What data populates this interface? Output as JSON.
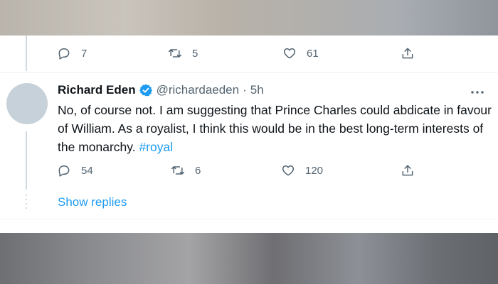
{
  "prev_tweet": {
    "actions": {
      "reply_count": "7",
      "retweet_count": "5",
      "like_count": "61"
    }
  },
  "tweet": {
    "author_name": "Richard Eden",
    "handle": "@richardaeden",
    "separator": "·",
    "time": "5h",
    "text_main": "No, of course not. I am suggesting that Prince Charles could abdicate in favour of William. As a royalist, I think this would be in the best long-term interests of the monarchy. ",
    "hashtag": "#royal",
    "actions": {
      "reply_count": "54",
      "retweet_count": "6",
      "like_count": "120"
    }
  },
  "show_replies_label": "Show replies",
  "colors": {
    "accent": "#1d9bf0",
    "muted": "#536471",
    "text": "#0f1419",
    "avatar": "#c6d1d9",
    "thread_line": "#cfd9de"
  },
  "icons": [
    "reply-icon",
    "retweet-icon",
    "like-icon",
    "share-icon",
    "verified-badge-icon",
    "more-icon"
  ]
}
